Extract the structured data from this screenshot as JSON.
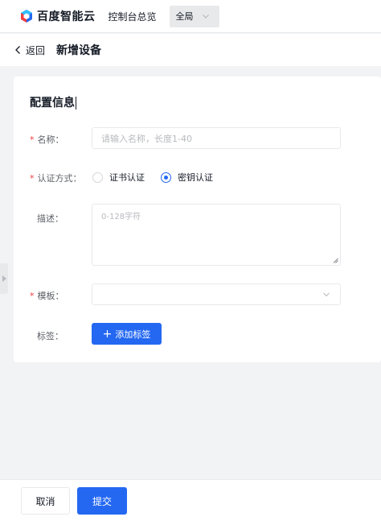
{
  "topnav": {
    "brand": "百度智能云",
    "console": "控制台总览",
    "region": "全局"
  },
  "header": {
    "back": "返回",
    "title": "新增设备"
  },
  "form": {
    "section_title": "配置信息",
    "name": {
      "label": "名称：",
      "placeholder": "请输入名称，长度1-40",
      "required": "*"
    },
    "auth": {
      "label": "认证方式：",
      "required": "*",
      "options": [
        "证书认证",
        "密钥认证"
      ],
      "selected": "密钥认证"
    },
    "description": {
      "label": "描述：",
      "placeholder": "0-128字符"
    },
    "template": {
      "label": "模板：",
      "required": "*",
      "value": ""
    },
    "tags": {
      "label": "标签：",
      "add_button": "添加标签"
    }
  },
  "footer": {
    "cancel": "取消",
    "submit": "提交"
  },
  "colors": {
    "primary": "#2468f2",
    "required": "#f33e3e"
  }
}
